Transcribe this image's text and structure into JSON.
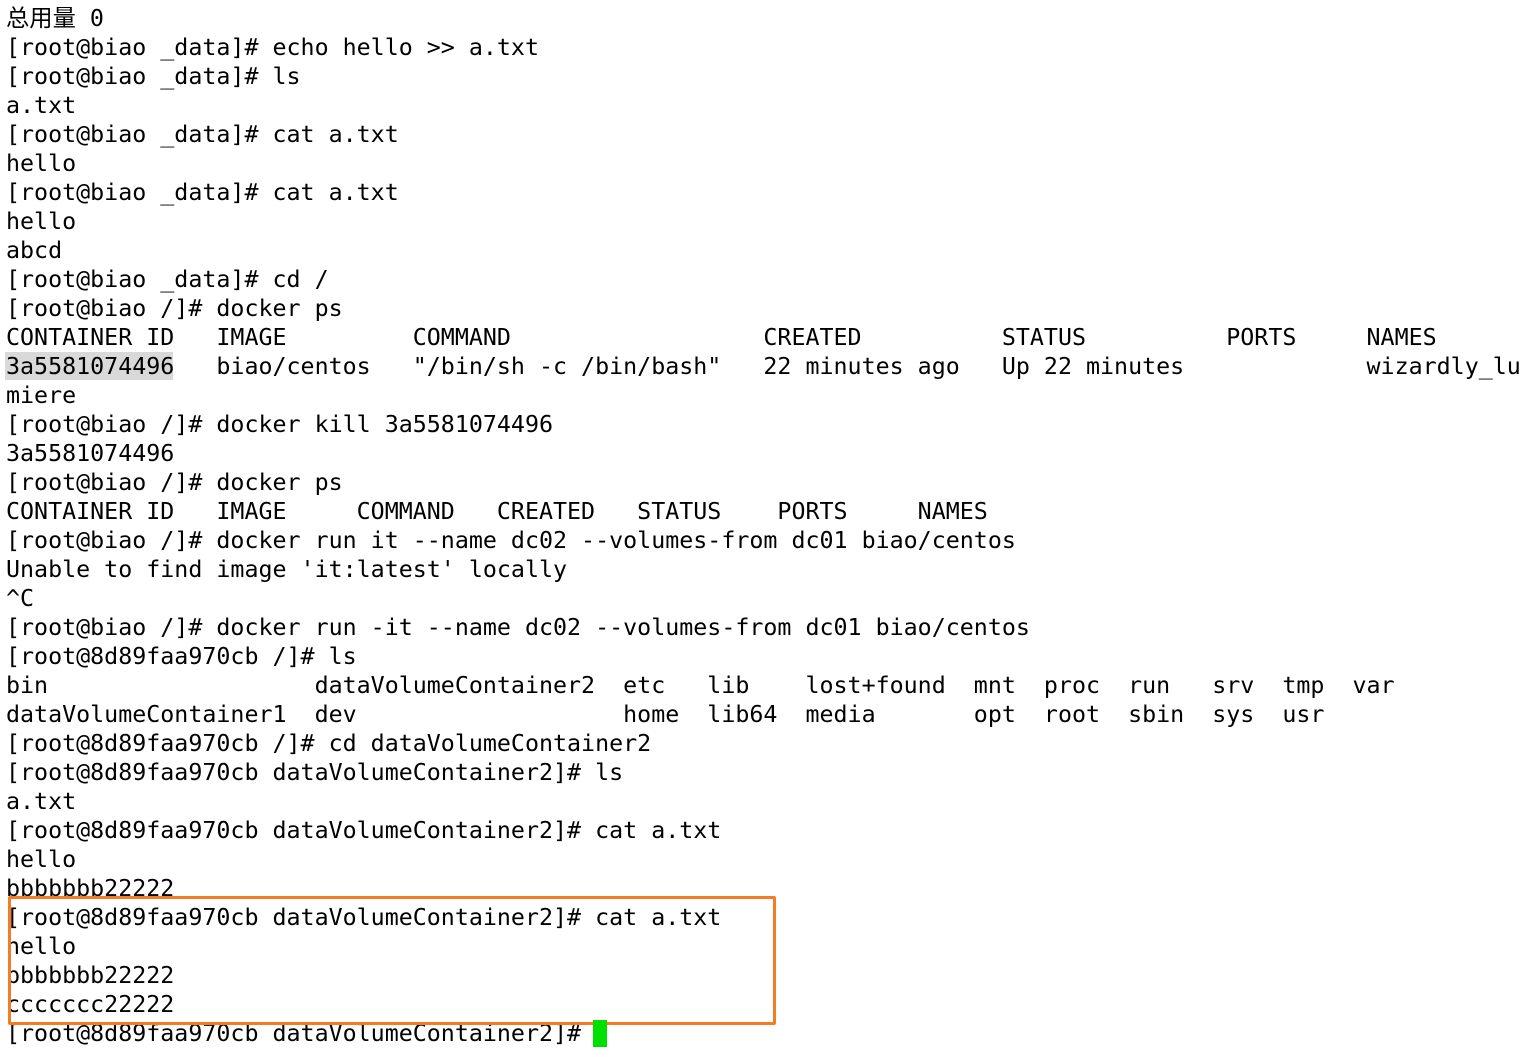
{
  "terminal": {
    "lines": [
      "总用量 0",
      "[root@biao _data]# echo hello >> a.txt",
      "[root@biao _data]# ls",
      "a.txt",
      "[root@biao _data]# cat a.txt",
      "hello",
      "[root@biao _data]# cat a.txt",
      "hello",
      "abcd",
      "[root@biao _data]# cd /",
      "[root@biao /]# docker ps",
      "CONTAINER ID   IMAGE         COMMAND                  CREATED          STATUS          PORTS     NAMES",
      "3a5581074496   biao/centos   \"/bin/sh -c /bin/bash\"   22 minutes ago   Up 22 minutes             wizardly_lu",
      "miere",
      "[root@biao /]# docker kill 3a5581074496",
      "3a5581074496",
      "[root@biao /]# docker ps",
      "CONTAINER ID   IMAGE     COMMAND   CREATED   STATUS    PORTS     NAMES",
      "[root@biao /]# docker run it --name dc02 --volumes-from dc01 biao/centos",
      "Unable to find image 'it:latest' locally",
      "^C",
      "[root@biao /]# docker run -it --name dc02 --volumes-from dc01 biao/centos",
      "[root@8d89faa970cb /]# ls",
      "bin                   dataVolumeContainer2  etc   lib    lost+found  mnt  proc  run   srv  tmp  var",
      "dataVolumeContainer1  dev                   home  lib64  media       opt  root  sbin  sys  usr",
      "[root@8d89faa970cb /]# cd dataVolumeContainer2",
      "[root@8d89faa970cb dataVolumeContainer2]# ls",
      "a.txt",
      "[root@8d89faa970cb dataVolumeContainer2]# cat a.txt",
      "hello",
      "bbbbbbb22222",
      "[root@8d89faa970cb dataVolumeContainer2]# cat a.txt",
      "hello",
      "bbbbbbb22222",
      "ccccccc22222",
      "[root@8d89faa970cb dataVolumeContainer2]# "
    ],
    "selected_text": "3a5581074496",
    "colors": {
      "background": "#ffffff",
      "text": "#000000",
      "selection": "#d9d9d9",
      "annotation_box": "#f57c22",
      "cursor": "#00e000"
    }
  }
}
